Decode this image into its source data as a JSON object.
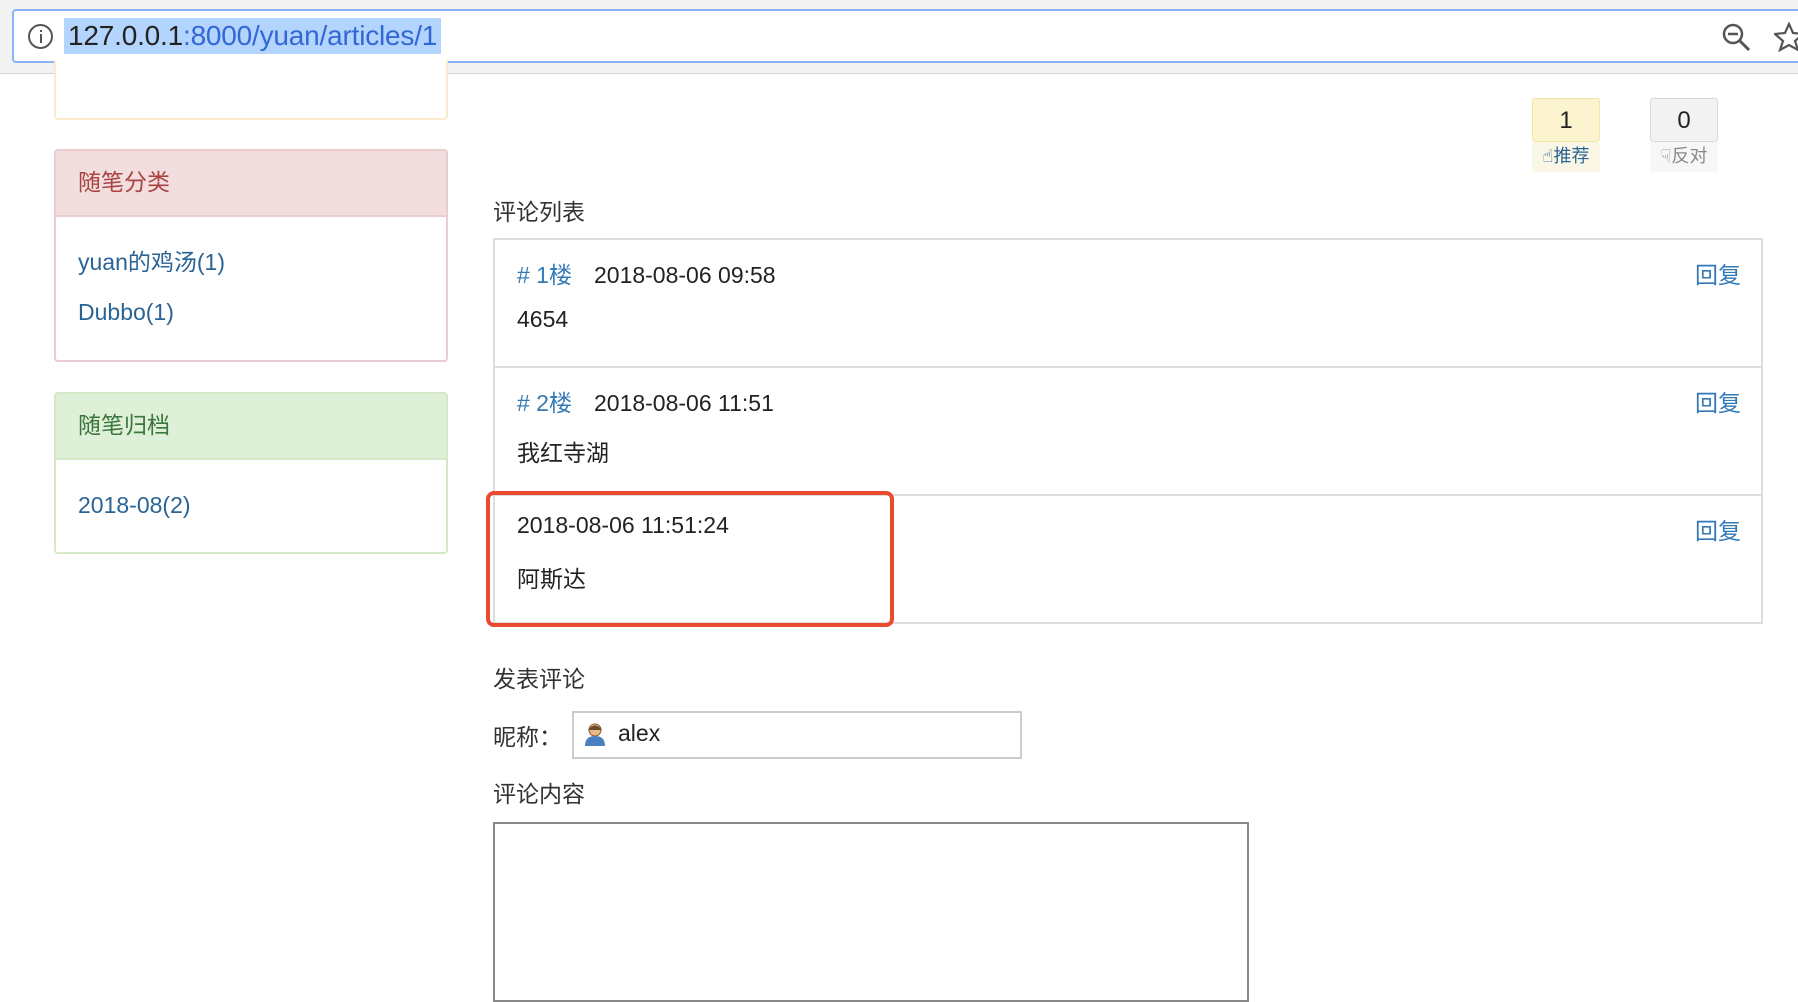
{
  "browser": {
    "url_host": "127.0.0.1",
    "url_path": ":8000/yuan/articles/1"
  },
  "sidebar": {
    "top_cut_text": "(·)",
    "category": {
      "title": "随笔分类",
      "items": [
        "yuan的鸡汤(1)",
        "Dubbo(1)"
      ]
    },
    "archive": {
      "title": "随笔归档",
      "items": [
        "2018-08(2)"
      ]
    }
  },
  "votes": {
    "up_count": "1",
    "up_label": "推荐",
    "down_count": "0",
    "down_label": "反对"
  },
  "comments": {
    "title": "评论列表",
    "reply_label": "回复",
    "items": [
      {
        "floor": "# 1楼",
        "time": "2018-08-06 09:58",
        "text": "4654"
      },
      {
        "floor": "# 2楼",
        "time": "2018-08-06 11:51",
        "text": "我红寺湖"
      },
      {
        "floor": "",
        "time": "2018-08-06 11:51:24",
        "text": "阿斯达"
      }
    ]
  },
  "form": {
    "title": "发表评论",
    "nick_label": "昵称：",
    "nick_value": "alex",
    "content_label": "评论内容"
  },
  "colors": {
    "highlight": "#ea4a2f",
    "link": "#337ab7"
  }
}
